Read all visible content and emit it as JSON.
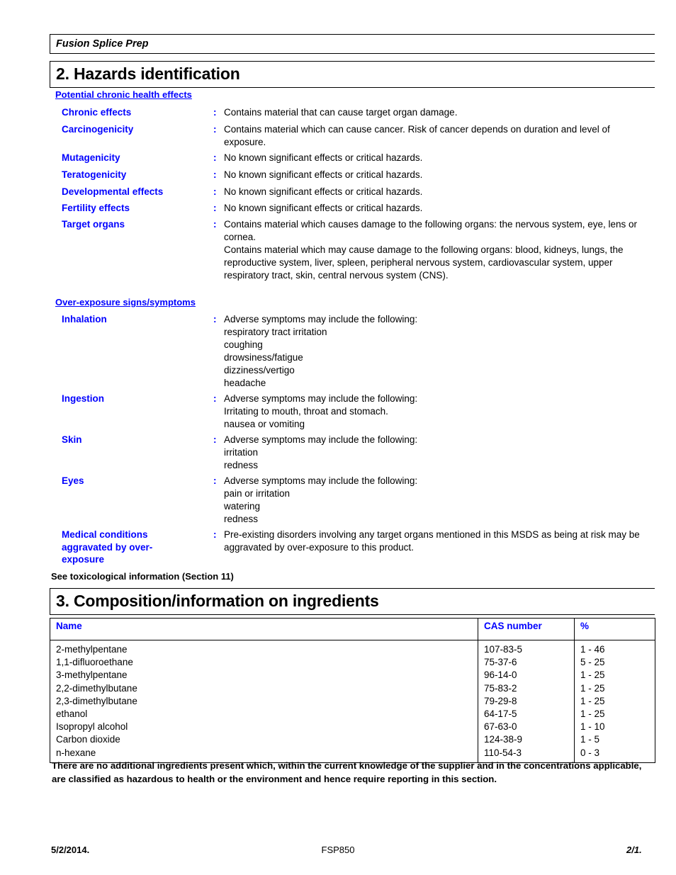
{
  "header": {
    "product_name": "Fusion Splice Prep"
  },
  "section2": {
    "title": "2. Hazards identification",
    "chronic_group_heading": "Potential chronic health effects",
    "chronic_rows": [
      {
        "label": "Chronic effects",
        "colon": ":",
        "value": "Contains material that can cause target organ damage."
      },
      {
        "label": "Carcinogenicity",
        "colon": ":",
        "value": "Contains material which can cause cancer.  Risk of cancer depends on duration and level of exposure."
      },
      {
        "label": "Mutagenicity",
        "colon": ":",
        "value": "No known significant effects or critical hazards."
      },
      {
        "label": "Teratogenicity",
        "colon": ":",
        "value": "No known significant effects or critical hazards."
      },
      {
        "label": "Developmental effects",
        "colon": ":",
        "value": "No known significant effects or critical hazards."
      },
      {
        "label": "Fertility effects",
        "colon": ":",
        "value": "No known significant effects or critical hazards."
      },
      {
        "label": "Target organs",
        "colon": ":",
        "value": "Contains material which causes damage to the following organs: the nervous system, eye, lens or cornea.\nContains material which may cause damage to the following organs: blood, kidneys, lungs, the reproductive system, liver, spleen, peripheral nervous system, cardiovascular system, upper respiratory tract, skin, central nervous system (CNS)."
      }
    ],
    "overexposure_group_heading": "Over-exposure signs/symptoms",
    "overexposure_rows": [
      {
        "label": "Inhalation",
        "colon": ":",
        "value": "Adverse symptoms may include the following:\nrespiratory tract irritation\ncoughing\ndrowsiness/fatigue\ndizziness/vertigo\nheadache"
      },
      {
        "label": "Ingestion",
        "colon": ":",
        "value": "Adverse symptoms may include the following:\nIrritating to mouth, throat and stomach.\nnausea or vomiting"
      },
      {
        "label": "Skin",
        "colon": ":",
        "value": "Adverse symptoms may include the following:\nirritation\nredness"
      },
      {
        "label": "Eyes",
        "colon": ":",
        "value": "Adverse symptoms may include the following:\npain or irritation\nwatering\nredness"
      }
    ],
    "medical_conditions": {
      "label": "Medical conditions aggravated by over-exposure",
      "colon": ":",
      "value": "Pre-existing disorders involving any target organs mentioned in this MSDS as being at risk may be aggravated by over-exposure to this product."
    },
    "toxicological_note": "See toxicological information (Section 11)"
  },
  "section3": {
    "title": "3. Composition/information on ingredients",
    "table": {
      "columns": [
        "Name",
        "CAS number",
        "%"
      ],
      "rows": [
        {
          "name": "2-methylpentane",
          "cas": "107-83-5",
          "pct": "1 - 46"
        },
        {
          "name": "1,1-difluoroethane",
          "cas": "75-37-6",
          "pct": "5 - 25"
        },
        {
          "name": "3-methylpentane",
          "cas": "96-14-0",
          "pct": "1 - 25"
        },
        {
          "name": "2,2-dimethylbutane",
          "cas": "75-83-2",
          "pct": "1 - 25"
        },
        {
          "name": "2,3-dimethylbutane",
          "cas": "79-29-8",
          "pct": "1 - 25"
        },
        {
          "name": "ethanol",
          "cas": "64-17-5",
          "pct": "1 - 25"
        },
        {
          "name": "Isopropyl alcohol",
          "cas": "67-63-0",
          "pct": "1 - 10"
        },
        {
          "name": "Carbon dioxide",
          "cas": "124-38-9",
          "pct": "1 - 5"
        },
        {
          "name": "n-hexane",
          "cas": "110-54-3",
          "pct": "0 - 3"
        }
      ]
    },
    "disclaimer": "There are no additional ingredients present which, within the current knowledge of the supplier and in the concentrations applicable, are classified as hazardous to health or the environment and hence require reporting in this section."
  },
  "footer": {
    "date": "5/2/2014.",
    "product_code": "FSP850",
    "page": "2/1."
  },
  "colors": {
    "heading_blue": "#0000ff",
    "text_black": "#000000",
    "rule": "#000000"
  }
}
